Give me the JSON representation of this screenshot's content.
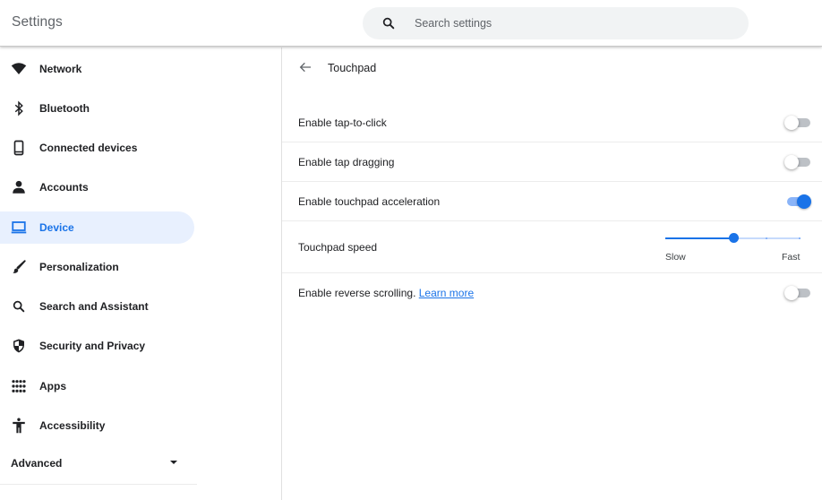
{
  "header": {
    "title": "Settings",
    "search": {
      "placeholder": "Search settings",
      "value": ""
    }
  },
  "sidebar": {
    "items": [
      {
        "id": "network",
        "label": "Network",
        "icon": "wifi-icon",
        "active": false
      },
      {
        "id": "bluetooth",
        "label": "Bluetooth",
        "icon": "bluetooth-icon",
        "active": false
      },
      {
        "id": "connected-devices",
        "label": "Connected devices",
        "icon": "phone-icon",
        "active": false
      },
      {
        "id": "accounts",
        "label": "Accounts",
        "icon": "person-icon",
        "active": false
      },
      {
        "id": "device",
        "label": "Device",
        "icon": "laptop-icon",
        "active": true
      },
      {
        "id": "personalization",
        "label": "Personalization",
        "icon": "brush-icon",
        "active": false
      },
      {
        "id": "search-assistant",
        "label": "Search and Assistant",
        "icon": "search-icon",
        "active": false
      },
      {
        "id": "security-privacy",
        "label": "Security and Privacy",
        "icon": "shield-icon",
        "active": false
      },
      {
        "id": "apps",
        "label": "Apps",
        "icon": "apps-grid-icon",
        "active": false
      },
      {
        "id": "accessibility",
        "label": "Accessibility",
        "icon": "accessibility-icon",
        "active": false
      }
    ],
    "advanced": {
      "label": "Advanced",
      "expanded": false
    }
  },
  "colors": {
    "accent": "#1a73e8",
    "active_bg": "#e8f0fe",
    "toggle_off_track": "#bdc1c6",
    "toggle_on_track": "#8ab4f8",
    "text_primary": "#202124",
    "text_secondary": "#5f6368"
  },
  "main": {
    "page_title": "Touchpad",
    "settings": [
      {
        "label": "Enable tap-to-click",
        "type": "toggle",
        "checked": false
      },
      {
        "label": "Enable tap dragging",
        "type": "toggle",
        "checked": false
      },
      {
        "label": "Enable touchpad acceleration",
        "type": "toggle",
        "checked": true
      },
      {
        "label": "Touchpad speed",
        "type": "slider",
        "min_label": "Slow",
        "max_label": "Fast",
        "steps": 5,
        "value": 3
      },
      {
        "label": "Enable reverse scrolling.",
        "link_text": "Learn more",
        "type": "toggle",
        "checked": false
      }
    ]
  }
}
